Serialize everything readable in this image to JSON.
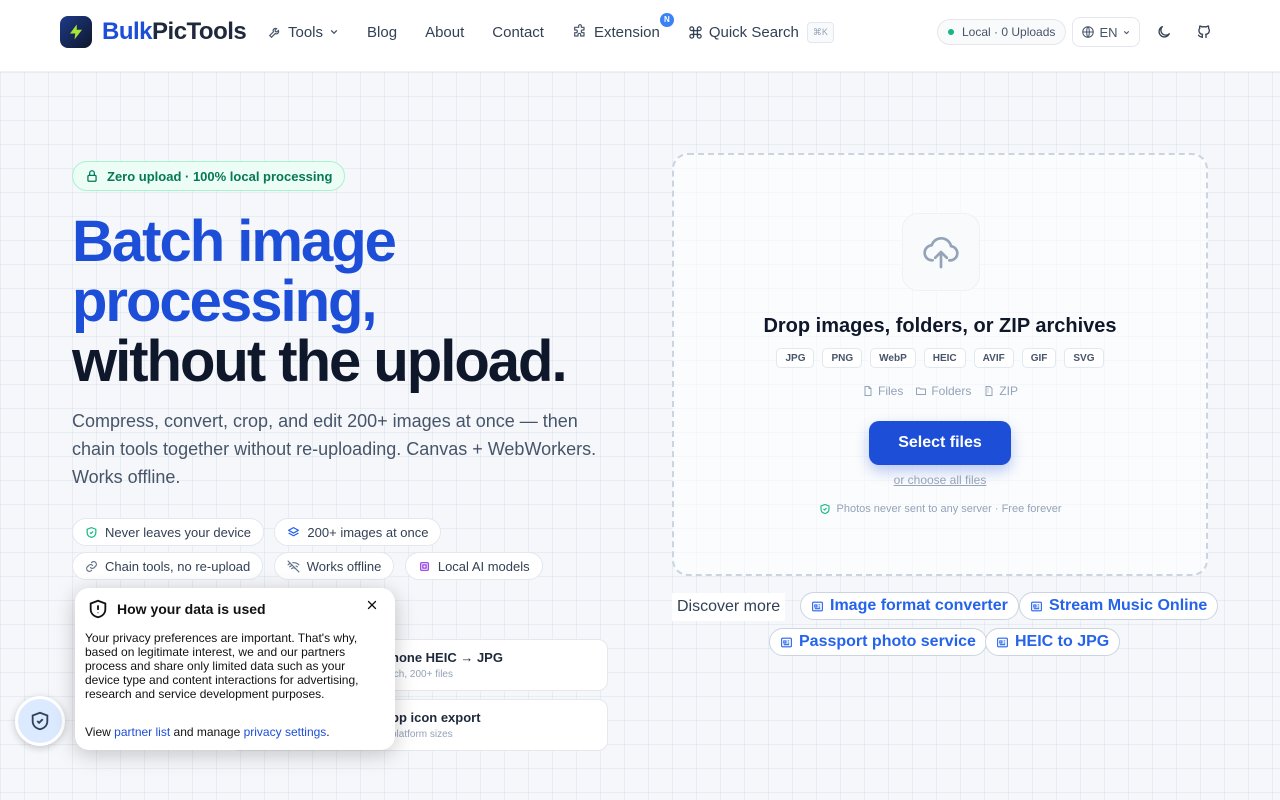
{
  "header": {
    "brand_part1": "Bulk",
    "brand_part2": "PicTools",
    "nav": {
      "tools": "Tools",
      "blog": "Blog",
      "about": "About",
      "contact": "Contact",
      "extension": "Extension",
      "extension_badge": "N",
      "quick_search": "Quick Search",
      "quick_search_kbd": "⌘K"
    },
    "local_status": "Local · 0 Uploads",
    "language": "EN"
  },
  "hero": {
    "badge": "Zero upload · 100% local processing",
    "headline_line1": "Batch image",
    "headline_line2": "processing,",
    "headline_line3": "without the upload.",
    "subtitle": "Compress, convert, crop, and edit 200+ images at once — then chain tools together without re-uploading. Canvas + WebWorkers. Works offline.",
    "features": [
      "Never leaves your device",
      "200+ images at once",
      "Chain tools, no re-upload",
      "Works offline",
      "Local AI models"
    ],
    "cards": [
      {
        "title": "hone HEIC → JPG",
        "sub": "tch, 200+ files"
      },
      {
        "title": "pp icon export",
        "sub": "platform sizes"
      }
    ]
  },
  "dropzone": {
    "title": "Drop images, folders, or ZIP archives",
    "formats": [
      "JPG",
      "PNG",
      "WebP",
      "HEIC",
      "AVIF",
      "GIF",
      "SVG"
    ],
    "sources": [
      "Files",
      "Folders",
      "ZIP"
    ],
    "select_button": "Select files",
    "choose_all": "or choose all files",
    "note": "Photos never sent to any server · Free forever"
  },
  "discover": {
    "label": "Discover more",
    "links": [
      "Image format converter",
      "Stream Music Online",
      "Passport photo service",
      "HEIC to JPG"
    ]
  },
  "privacy": {
    "title": "How your data is used",
    "body": "Your privacy preferences are important. That's why, based on legitimate interest, we and our partners process and share only limited data such as your device type and content interactions for advertising, research and service development purposes.",
    "view": "View",
    "partner_list": "partner list",
    "and_manage": "and manage",
    "privacy_settings": "privacy settings",
    "period": "."
  },
  "colors": {
    "brand_blue": "#1d4ed8",
    "accent_green": "#10b981",
    "link_blue": "#2563eb"
  }
}
